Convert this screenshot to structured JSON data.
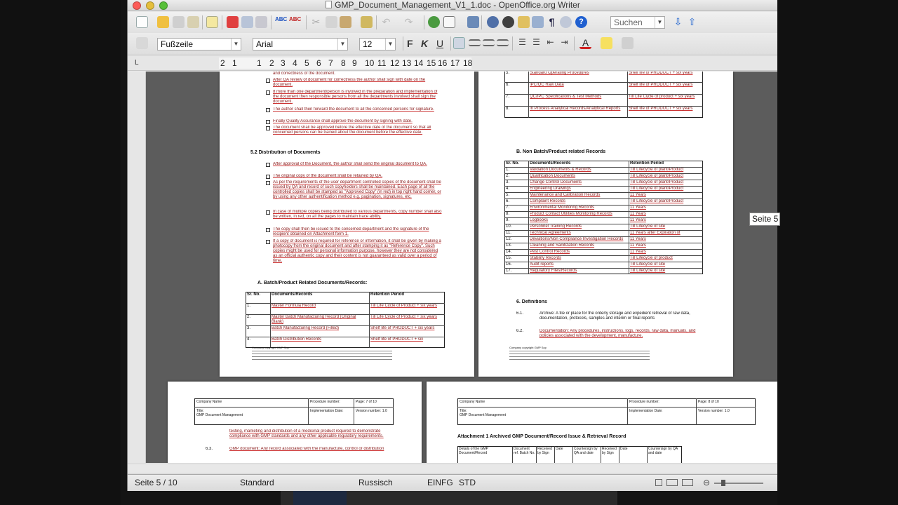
{
  "window": {
    "title": "GMP_Document_Management_V1_1.doc - OpenOffice.org Writer"
  },
  "toolbar2": {
    "paragraph_style": "Fußzeile",
    "font_name": "Arial",
    "font_size": "12",
    "bold_label": "F",
    "italic_label": "K",
    "underline_label": "U"
  },
  "search": {
    "placeholder": "Suchen"
  },
  "ruler": {
    "numbers": [
      "2",
      "1",
      "1",
      "2",
      "3",
      "4",
      "5",
      "6",
      "7",
      "8",
      "9",
      "10",
      "11",
      "12",
      "13",
      "14",
      "15",
      "16",
      "17",
      "18"
    ]
  },
  "tooltip": {
    "text": "Seite 5"
  },
  "statusbar": {
    "page": "Seite 5 / 10",
    "page_style": "Standard",
    "language": "Russisch",
    "insert_mode": "EINFG",
    "selection_mode": "STD"
  },
  "page_left": {
    "items": [
      "and correctness of the document.",
      "After QA review of document for correctness the author shall sign with date on the document.",
      "If more than one department/person is involved in the preparation and implementation of the document then responsible persons from all the departments involved shall sign the document.",
      "The author shall then forward the document to all the concerned persons for signature.",
      "Finally Quality Assurance shall approve the document by signing with date.",
      "The document shall be approved before the effective date of the document so that all concerned persons can be trained about the document before the effective date."
    ],
    "section_heading": "5.2 Distribution of Documents",
    "items2": [
      "After approval of the Document, the author shall send the original document to QA.",
      "The original copy of the document shall be retained by QA.",
      "As per the requirements of the user department controlled copies of the document shall be issued by QA and record of such copyholders shall be maintained. Each page of all the controlled copies shall be stamped as \"Approved Copy\" (in red) in top right hand corner, or by using any other authentification method e.g. pagination, signatures, etc.",
      "In case of multiple copies being distributed to various departments, copy number shall also be written, in red, on all the pages to maintain trace ability.",
      "The copy shall then be issued to the concerned department and the signature of the recipient obtained on Attachment form 1.",
      "If a copy of document is required for reference or information, it shall be given by making a photocopy from the original document and after stamping it as \"Reference Copy\". Such copies might be used for personal information purpose, however they are not considered as an official authentic copy and their content is not guaranteed as valid over a period of time."
    ],
    "subsection_heading": "A. Batch/Product Related Documents/Records:",
    "table_headers": [
      "Sr. No.",
      "Documents/Records",
      "Retention Period"
    ],
    "table_rows": [
      [
        "1.",
        "Master Formula Record",
        "Till Life Cycle of Product + six years"
      ],
      [
        "2.",
        "Master Batch Manufacturing Record (Original Blank)",
        "Till Life Cycle of Product + six years"
      ],
      [
        "3.",
        "Batch Manufacturing Record (Filled)",
        "Shelf life of PRODUCT + six years"
      ],
      [
        "4.",
        "Batch Distribution Records",
        "Shelf life of PRODUCT + six"
      ]
    ],
    "footer_note": "Company copyright GMP Sop"
  },
  "page_right": {
    "top_rows": [
      [
        "5.",
        "Standard Operating Procedures",
        "Shelf life of PRODUCT + six years"
      ],
      [
        "6.",
        "IPC/QC Raw Data",
        "Shelf life of PRODUCT + six years"
      ],
      [
        "7.",
        "QC/IPC Specifications & Test Methods",
        "Till Life Cycle of product + six years"
      ],
      [
        "8.",
        "In Process Analytical Records/Analytical Reports",
        "Shelf life of PRODUCT + six years"
      ]
    ],
    "section_heading": "B. Non Batch/Product related Records",
    "table_headers": [
      "Sr. No.",
      "Documents/Records",
      "Retention Period"
    ],
    "table_rows": [
      [
        "1.",
        "Validation Documents & Records",
        "Till Lifecycle of plant/Product"
      ],
      [
        "2.",
        "Qualification Documents",
        "Till Lifecycle of plant/Product"
      ],
      [
        "3.",
        "Change Control Documents",
        "Till Lifecycle of plant/Product"
      ],
      [
        "4.",
        "Engineering Drawings",
        "Till Lifecycle of plant/Product"
      ],
      [
        "5.",
        "Maintenance and Calibration Records",
        "11 Years"
      ],
      [
        "6.",
        "Complaint Records",
        "Till Lifecycle of plant/Product"
      ],
      [
        "7.",
        "Environmental Monitoring Records",
        "11 Years"
      ],
      [
        "8.",
        "Product Contact Utilities Monitoring Records",
        "11 Years"
      ],
      [
        "9.",
        "Logbooks",
        "11 Years"
      ],
      [
        "10.",
        "Personnel Training Records",
        "Till Lifecycle of site"
      ],
      [
        "11.",
        "Technical Agreements",
        "11 Years after Expiration of Agreements"
      ],
      [
        "12.",
        "Deviations/Non Compliance Investigation Records",
        "11 Years"
      ],
      [
        "13.",
        "Cleaning and Sanitization Records",
        "11 Years"
      ],
      [
        "14.",
        "Pest Control Records",
        "11 Years"
      ],
      [
        "15.",
        "Stability Records",
        "Till Lifecycle of product"
      ],
      [
        "16.",
        "Audit reports",
        "Till Lifecycle of site"
      ],
      [
        "17.",
        "Regulatory Files/Records",
        "Till Lifecycle of site"
      ]
    ],
    "definitions_heading": "6. Definitions",
    "def1_num": "6.1.",
    "def1": "Archive: A file or place for the orderly storage and expedient retrieval of raw data, documentation, protocols, samples and interim or final reports",
    "def2_num": "6.2.",
    "def2": "Documentation: Any procedures, instructions, logs, records, raw data, manuals, and policies associated with the development, manufacture,",
    "footer_note": "Company copyright GMP Sop"
  },
  "page_bottom_left": {
    "header": {
      "company": "Company Name",
      "procedure": "Procedure number:",
      "page": "Page: 7 of 10",
      "title_label": "Title:",
      "title": "GMP Document Management",
      "impl": "Implementation Date:",
      "version": "Version number: 1.0"
    },
    "text1": "testing, marketing and distribution of a medicinal product required to demonstrate compliance with GMP standards and any other applicable regulatory requirements.",
    "def_num": "6.3.",
    "def": "GMP document: Any record associated with the manufacture, control or distribution"
  },
  "page_bottom_right": {
    "header": {
      "company": "Company Name",
      "procedure": "Procedure number:",
      "page": "Page: 8 of 10",
      "title_label": "Title:",
      "title": "GMP Document Management",
      "impl": "Implementation Date:",
      "version": "Version number: 1.0"
    },
    "attachment_title": "Attachment 1 Archived GMP Document/Record Issue & Retrieval Record",
    "table_headers": [
      "Details of the GMP Document/Record",
      "Document ref. Batch No.",
      "Received by Sign",
      "Date",
      "Countersign by QA and date",
      "Received by Sign",
      "Date",
      "Countersign by QA and date"
    ]
  }
}
